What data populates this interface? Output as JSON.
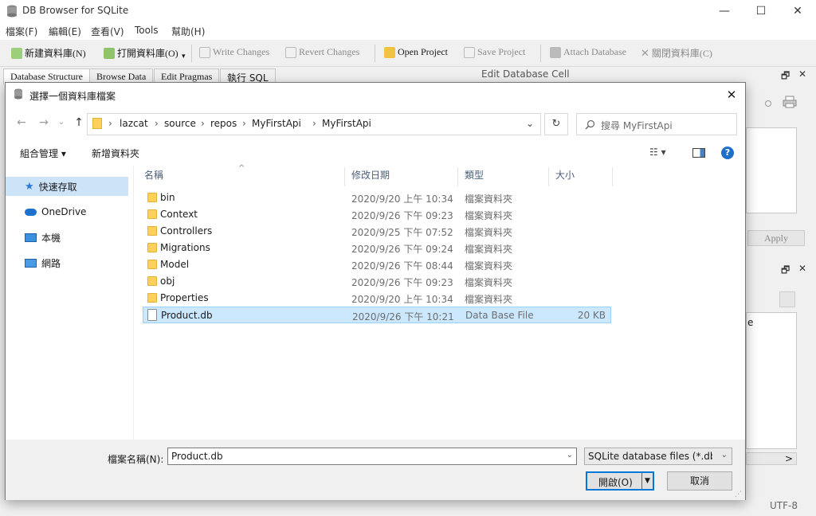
{
  "app": {
    "title": "DB Browser for SQLite",
    "window_controls": [
      "—",
      "☐",
      "✕"
    ]
  },
  "menu": [
    "檔案(F)",
    "編輯(E)",
    "查看(V)",
    "Tools",
    "幫助(H)"
  ],
  "toolbar": {
    "new_db": "新建資料庫(N)",
    "open_db": "打開資料庫(O)",
    "write_changes": "Write Changes",
    "revert_changes": "Revert Changes",
    "open_project": "Open Project",
    "save_project": "Save Project",
    "attach_db": "Attach Database",
    "close_db": "關閉資料庫(C)"
  },
  "tabs": [
    "Database Structure",
    "Browse Data",
    "Edit Pragmas",
    "執行 SQL"
  ],
  "right_pane": {
    "edit_cell_title": "Edit Database Cell",
    "apply": "Apply",
    "float_icon": "🗗",
    "close_icon": "✕",
    "fragment": "e",
    "scroll_right": ">",
    "encoding": "UTF-8"
  },
  "dialog": {
    "title": "選擇一個資料庫檔案",
    "close": "✕",
    "nav": {
      "back": "←",
      "forward": "→",
      "up": "↑",
      "recent": "⌄"
    },
    "breadcrumb": [
      "lazcat",
      "source",
      "repos",
      "MyFirstApi",
      "MyFirstApi"
    ],
    "breadcrumb_sep": "›",
    "refresh": "↻",
    "search_placeholder": "搜尋 MyFirstApi",
    "commands": {
      "organize": "組合管理 ▾",
      "new_folder": "新增資料夾"
    },
    "sidebar": [
      {
        "label": "快速存取",
        "icon": "star-icon"
      },
      {
        "label": "OneDrive",
        "icon": "cloud-icon"
      },
      {
        "label": "本機",
        "icon": "computer-icon"
      },
      {
        "label": "網路",
        "icon": "network-icon"
      }
    ],
    "columns": [
      "名稱",
      "修改日期",
      "類型",
      "大小"
    ],
    "sort_indicator": "^",
    "files": [
      {
        "name": "bin",
        "date": "2020/9/20 上午 10:34",
        "type": "檔案資料夾",
        "size": "",
        "kind": "folder"
      },
      {
        "name": "Context",
        "date": "2020/9/26 下午 09:23",
        "type": "檔案資料夾",
        "size": "",
        "kind": "folder"
      },
      {
        "name": "Controllers",
        "date": "2020/9/25 下午 07:52",
        "type": "檔案資料夾",
        "size": "",
        "kind": "folder"
      },
      {
        "name": "Migrations",
        "date": "2020/9/26 下午 09:24",
        "type": "檔案資料夾",
        "size": "",
        "kind": "folder"
      },
      {
        "name": "Model",
        "date": "2020/9/26 下午 08:44",
        "type": "檔案資料夾",
        "size": "",
        "kind": "folder"
      },
      {
        "name": "obj",
        "date": "2020/9/26 下午 09:23",
        "type": "檔案資料夾",
        "size": "",
        "kind": "folder"
      },
      {
        "name": "Properties",
        "date": "2020/9/20 上午 10:34",
        "type": "檔案資料夾",
        "size": "",
        "kind": "folder"
      },
      {
        "name": "Product.db",
        "date": "2020/9/26 下午 10:21",
        "type": "Data Base File",
        "size": "20 KB",
        "kind": "file"
      }
    ],
    "filename_label": "檔案名稱(N):",
    "filename_value": "Product.db",
    "filter_value": "SQLite database files (*.db *.s",
    "open_button": "開啟(O)",
    "cancel_button": "取消"
  },
  "colors": {
    "accent": "#0078d7",
    "selection": "#cce8ff",
    "folder": "#ffd05a"
  }
}
